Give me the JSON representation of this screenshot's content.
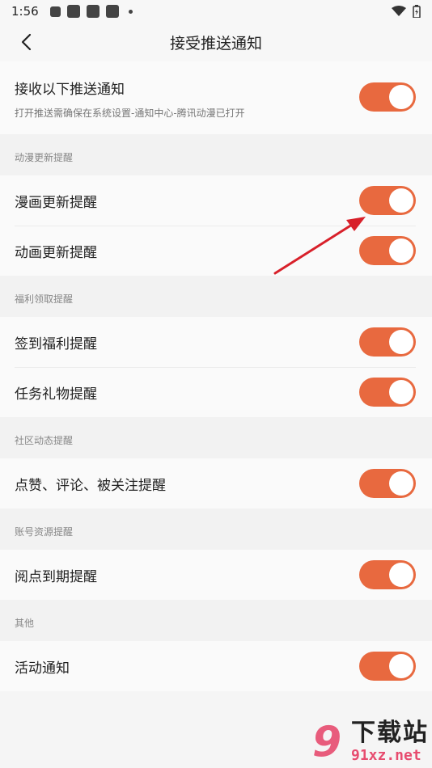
{
  "status_bar": {
    "time": "1:56"
  },
  "header": {
    "title": "接受推送通知"
  },
  "master": {
    "label": "接收以下推送通知",
    "subtitle": "打开推送需确保在系统设置-通知中心-腾讯动漫已打开",
    "enabled": true
  },
  "sections": [
    {
      "header": "动漫更新提醒",
      "items": [
        {
          "label": "漫画更新提醒",
          "enabled": true
        },
        {
          "label": "动画更新提醒",
          "enabled": true
        }
      ]
    },
    {
      "header": "福利领取提醒",
      "items": [
        {
          "label": "签到福利提醒",
          "enabled": true
        },
        {
          "label": "任务礼物提醒",
          "enabled": true
        }
      ]
    },
    {
      "header": "社区动态提醒",
      "items": [
        {
          "label": "点赞、评论、被关注提醒",
          "enabled": true
        }
      ]
    },
    {
      "header": "账号资源提醒",
      "items": [
        {
          "label": "阅点到期提醒",
          "enabled": true
        }
      ]
    },
    {
      "header": "其他",
      "items": [
        {
          "label": "活动通知",
          "enabled": true
        }
      ]
    }
  ],
  "colors": {
    "toggle_on": "#e8693f",
    "annotation_arrow": "#d8202a"
  },
  "watermark": {
    "logo": "9",
    "main": "下载站",
    "url": "91xz.net"
  }
}
